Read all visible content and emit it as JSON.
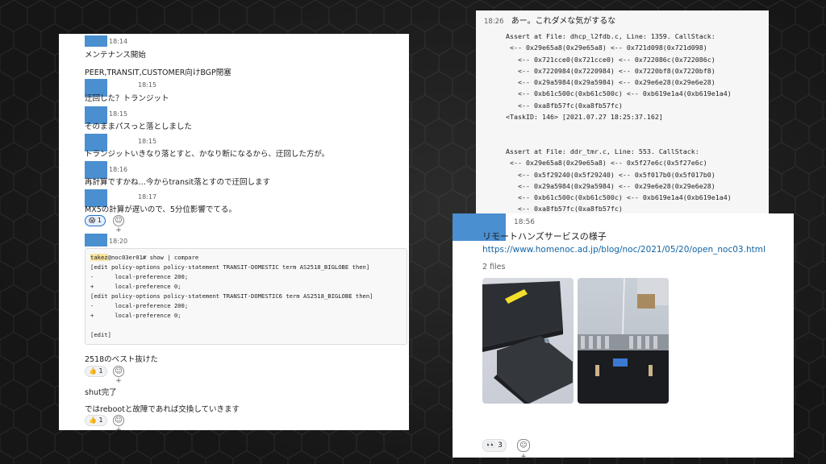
{
  "left_panel": {
    "messages": [
      {
        "time": "18:14",
        "lines": [
          "メンテナンス開始",
          "PEER,TRANSIT,CUSTOMER向けBGP閉塞"
        ]
      },
      {
        "time": "18:15",
        "lines": [
          "迂回した？トランジット"
        ]
      },
      {
        "time": "18:15",
        "lines": [
          "そのままパスっと落としました"
        ]
      },
      {
        "time": "18:15",
        "lines": [
          "トランジットいきなり落とすと、かなり断になるから、迂回した方が。"
        ]
      },
      {
        "time": "18:16",
        "lines": [
          "再計算ですかね…今からtransit落とすので迂回します"
        ]
      },
      {
        "time": "18:17",
        "lines": [
          "MX5の計算が遅いので、5分位影響でてる。"
        ]
      }
    ],
    "reaction_scream": {
      "emoji": "😱",
      "count": "1"
    },
    "code_message_time": "18:20",
    "code_lines": [
      {
        "user": "takez",
        "rest": "@noc03er01# show | compare"
      },
      {
        "text": "[edit policy-options policy-statement TRANSIT-DOMESTIC term AS2518_BIGLOBE then]"
      },
      {
        "text": "-      local-preference 200;"
      },
      {
        "text": "+      local-preference 0;"
      },
      {
        "text": "[edit policy-options policy-statement TRANSIT-DOMESTIC6 term AS2518_BIGLOBE then]"
      },
      {
        "text": "-      local-preference 200;"
      },
      {
        "text": "+      local-preference 0;"
      },
      {
        "text": ""
      },
      {
        "text": "[edit]"
      }
    ],
    "after_code": [
      {
        "text": "2518のベスト抜けた",
        "reaction": {
          "emoji": "👍",
          "count": "1"
        }
      },
      {
        "text": "shut完了"
      },
      {
        "text": "ではrebootと故障であれば交換していきます",
        "reaction": {
          "emoji": "👍",
          "count": "1"
        }
      }
    ],
    "add_reaction_label": "☺+"
  },
  "top_right": {
    "time": "18:26",
    "text": "あー。これダメな気がするな",
    "code_lines": [
      "Assert at File: dhcp_l2fdb.c, Line: 1359. CallStack:",
      " <-- 0x29e65a8(0x29e65a8) <-- 0x721d098(0x721d098)",
      "   <-- 0x721cce0(0x721cce0) <-- 0x722086c(0x722086c)",
      "   <-- 0x7220984(0x7220984) <-- 0x7220bf8(0x7220bf8)",
      "   <-- 0x29a5984(0x29a5984) <-- 0x29e6e28(0x29e6e28)",
      "   <-- 0xb61c500c(0xb61c500c) <-- 0xb619e1a4(0xb619e1a4)",
      "   <-- 0xa8fb57fc(0xa8fb57fc)",
      "<TaskID: 146> [2021.07.27 18:25:37.162]",
      "",
      "",
      "Assert at File: ddr_tmr.c, Line: 553. CallStack:",
      " <-- 0x29e65a8(0x29e65a8) <-- 0x5f27e6c(0x5f27e6c)",
      "   <-- 0x5f29240(0x5f29240) <-- 0x5f017b0(0x5f017b0)",
      "   <-- 0x29a5984(0x29a5984) <-- 0x29e6e28(0x29e6e28)",
      "   <-- 0xb61c500c(0xb61c500c) <-- 0xb619e1a4(0xb619e1a4)",
      "   <-- 0xa8fb57fc(0xa8fb57fc)"
    ]
  },
  "bottom_right": {
    "time": "18:56",
    "title": "リモートハンズサービスの様子",
    "link": "https://www.homenoc.ad.jp/blog/noc/2021/05/20/open_noc03.html",
    "files_label": "2 files",
    "reaction": {
      "emoji": "👀",
      "count": "3"
    },
    "add_reaction_label": "☺+"
  },
  "colors": {
    "avatar": "#4a8fd0",
    "link": "#1264a3",
    "highlight": "#f7e4a0"
  }
}
